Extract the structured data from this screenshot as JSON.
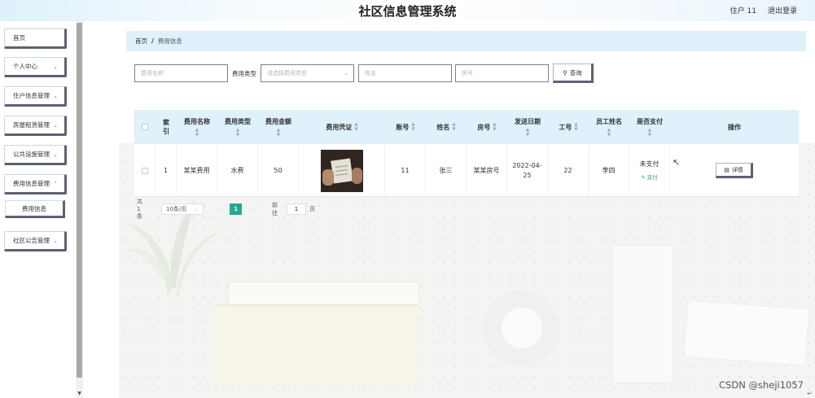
{
  "header": {
    "title": "社区信息管理系统",
    "user": "住户 11",
    "logout": "退出登录"
  },
  "sidebar": {
    "items": [
      {
        "label": "首页",
        "has_arrow": false
      },
      {
        "label": "个人中心",
        "has_arrow": true
      },
      {
        "label": "住户信息管理",
        "has_arrow": true
      },
      {
        "label": "房屋租赁管理",
        "has_arrow": true
      },
      {
        "label": "公共设施管理",
        "has_arrow": true
      },
      {
        "label": "费用信息管理",
        "has_arrow": true,
        "expanded": true
      },
      {
        "label": "费用信息",
        "submenu": true
      },
      {
        "label": "社区公告管理",
        "has_arrow": true
      }
    ]
  },
  "breadcrumb": {
    "home": "首页",
    "separator": "/",
    "current": "费用信息"
  },
  "search": {
    "fee_name_placeholder": "费用名称",
    "fee_type_label": "费用类型",
    "fee_type_placeholder": "请选择费用类型",
    "name_placeholder": "姓名",
    "room_placeholder": "房号",
    "query_button": "查询"
  },
  "table": {
    "headers": [
      "索引",
      "费用名称",
      "费用类型",
      "费用金额",
      "费用凭证",
      "账号",
      "姓名",
      "房号",
      "发送日期",
      "工号",
      "员工姓名",
      "是否支付",
      "操作"
    ],
    "rows": [
      {
        "index": "1",
        "fee_name": "某某费用",
        "fee_type": "水费",
        "amount": "50",
        "account": "11",
        "name": "张三",
        "room": "某某房号",
        "date": "2022-04-25",
        "staff_no": "22",
        "staff_name": "李四",
        "paid": "未支付",
        "pay_link": "支付",
        "action": "详情"
      }
    ]
  },
  "pagination": {
    "total": "共 1 条",
    "page_size": "10条/页",
    "current_page": "1",
    "goto_label": "前往",
    "goto_value": "1",
    "page_suffix": "页"
  },
  "watermark": "CSDN @sheji1057",
  "colors": {
    "accent": "#2aa78f",
    "header_bg": "#dff1fb",
    "button_shadow": "#5c6174"
  }
}
